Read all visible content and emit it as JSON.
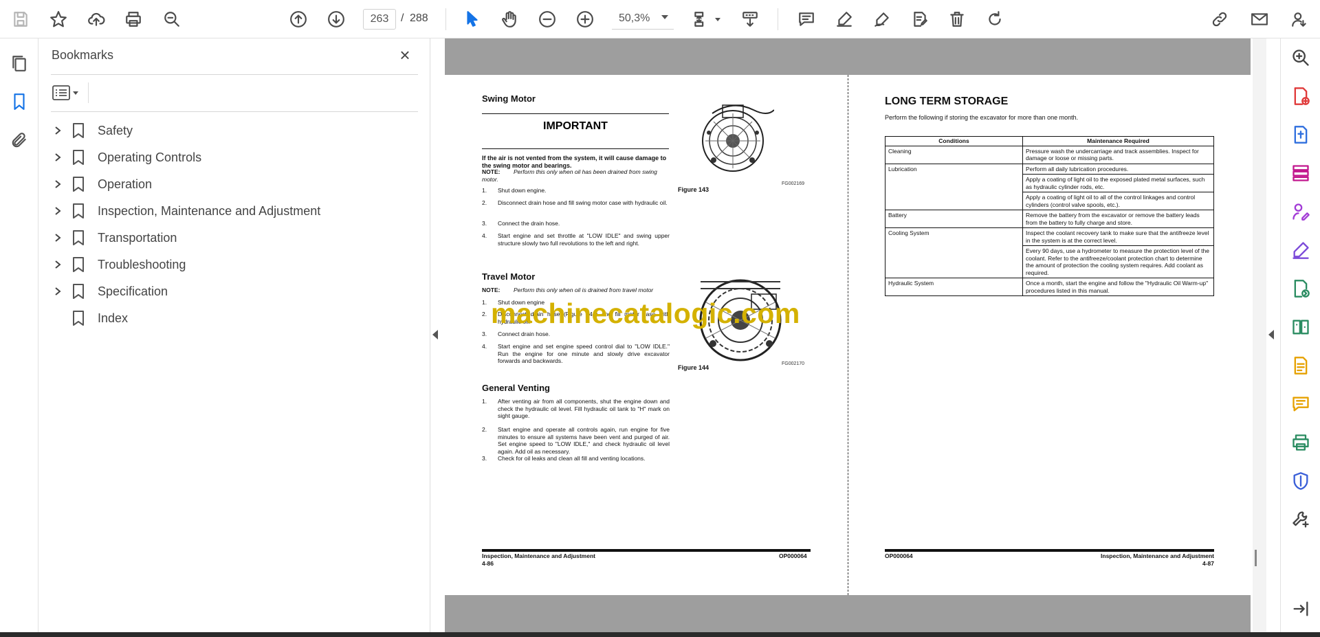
{
  "toolbar": {
    "current_page": "263",
    "separator": "/",
    "total_pages": "288",
    "zoom": "50,3%"
  },
  "bookmarks_panel": {
    "title": "Bookmarks",
    "items": [
      {
        "label": "Safety",
        "expandable": true
      },
      {
        "label": "Operating Controls",
        "expandable": true
      },
      {
        "label": "Operation",
        "expandable": true
      },
      {
        "label": "Inspection, Maintenance and Adjustment",
        "expandable": true
      },
      {
        "label": "Transportation",
        "expandable": true
      },
      {
        "label": "Troubleshooting",
        "expandable": true
      },
      {
        "label": "Specification",
        "expandable": true
      },
      {
        "label": "Index",
        "expandable": false
      }
    ]
  },
  "document": {
    "watermark": "machinecatalogic.com",
    "left_page": {
      "swing_motor": {
        "heading": "Swing Motor",
        "important_title": "IMPORTANT",
        "important_text": "If the air is not vented from the system, it will cause damage to the swing motor and bearings.",
        "note_label": "NOTE:",
        "note_text": "Perform this only when oil has been drained from swing motor.",
        "steps": [
          {
            "n": "1.",
            "text": "Shut down engine."
          },
          {
            "n": "2.",
            "text": "Disconnect drain hose and fill swing motor case with hydraulic oil."
          },
          {
            "n": "3.",
            "text": "Connect the drain hose."
          },
          {
            "n": "4.",
            "text": "Start engine and set throttle at \"LOW IDLE\" and swing upper structure slowly two full revolutions to the left and right."
          }
        ],
        "figure_caption": "Figure 143",
        "figure_code": "FG002169"
      },
      "travel_motor": {
        "heading": "Travel Motor",
        "note_label": "NOTE:",
        "note_text": "Perform this only when oil is drained from travel motor",
        "steps": [
          {
            "n": "1.",
            "text": "Shut down engine"
          },
          {
            "n": "2.",
            "text": "Disconnect drain hose (Figure 144) and fill motor case with hydraulic oil."
          },
          {
            "n": "3.",
            "text": "Connect drain hose."
          },
          {
            "n": "4.",
            "text": "Start engine and set engine speed control dial to \"LOW IDLE.\" Run the engine for one minute and slowly drive excavator forwards and backwards."
          }
        ],
        "figure_caption": "Figure 144",
        "figure_code": "FG002170"
      },
      "general_venting": {
        "heading": "General Venting",
        "steps": [
          {
            "n": "1.",
            "text": "After venting air from all components, shut the engine down and check the hydraulic oil level. Fill hydraulic oil tank to \"H\" mark on sight gauge."
          },
          {
            "n": "2.",
            "text": "Start engine and operate all controls again, run engine for five minutes to ensure all systems have been vent and purged of air. Set engine speed to \"LOW IDLE,\" and check hydraulic oil level again. Add oil as necessary."
          },
          {
            "n": "3.",
            "text": "Check for oil leaks and clean all fill and venting locations."
          }
        ]
      },
      "footer": {
        "section": "Inspection, Maintenance and Adjustment",
        "page": "4-86",
        "doc_id": "OP000064"
      }
    },
    "right_page": {
      "title": "LONG TERM STORAGE",
      "intro": "Perform the following if storing the excavator for more than one month.",
      "table": {
        "headers": [
          "Conditions",
          "Maintenance Required"
        ],
        "rows": [
          {
            "condition": "Cleaning",
            "items": [
              "Pressure wash the undercarriage and track assemblies. Inspect for damage or loose or missing parts."
            ]
          },
          {
            "condition": "Lubrication",
            "items": [
              "Perform all daily lubrication procedures.",
              "Apply a coating of light oil to the exposed plated metal surfaces, such as hydraulic cylinder rods, etc.",
              "Apply a coating of light oil to all of the control linkages and control cylinders (control valve spools, etc.)."
            ]
          },
          {
            "condition": "Battery",
            "items": [
              "Remove the battery from the excavator or remove the battery leads from the battery to fully charge and store."
            ]
          },
          {
            "condition": "Cooling System",
            "items": [
              "Inspect the coolant recovery tank to make sure that the antifreeze level in the system is at the correct level.",
              "Every 90 days, use a hydrometer to measure the protection level of the coolant. Refer to the antifreeze/coolant protection chart to determine the amount of protection the cooling system requires. Add coolant as required."
            ]
          },
          {
            "condition": "Hydraulic System",
            "items": [
              "Once a month, start the engine and follow the \"Hydraulic Oil Warm-up\" procedures listed in this manual."
            ]
          }
        ]
      },
      "footer": {
        "doc_id": "OP000064",
        "section": "Inspection, Maintenance and Adjustment",
        "page": "4-87"
      }
    }
  },
  "icons": {
    "accent": "#1473e6",
    "right_rail_colors": [
      "#e03a3a",
      "#2f6fde",
      "#c2188e",
      "#a23bd6",
      "#7c4bd9",
      "#2a8c61",
      "#2a8c61",
      "#e6a100",
      "#e6a100",
      "#2a8c61",
      "#3a5fd8",
      "#444444"
    ]
  }
}
